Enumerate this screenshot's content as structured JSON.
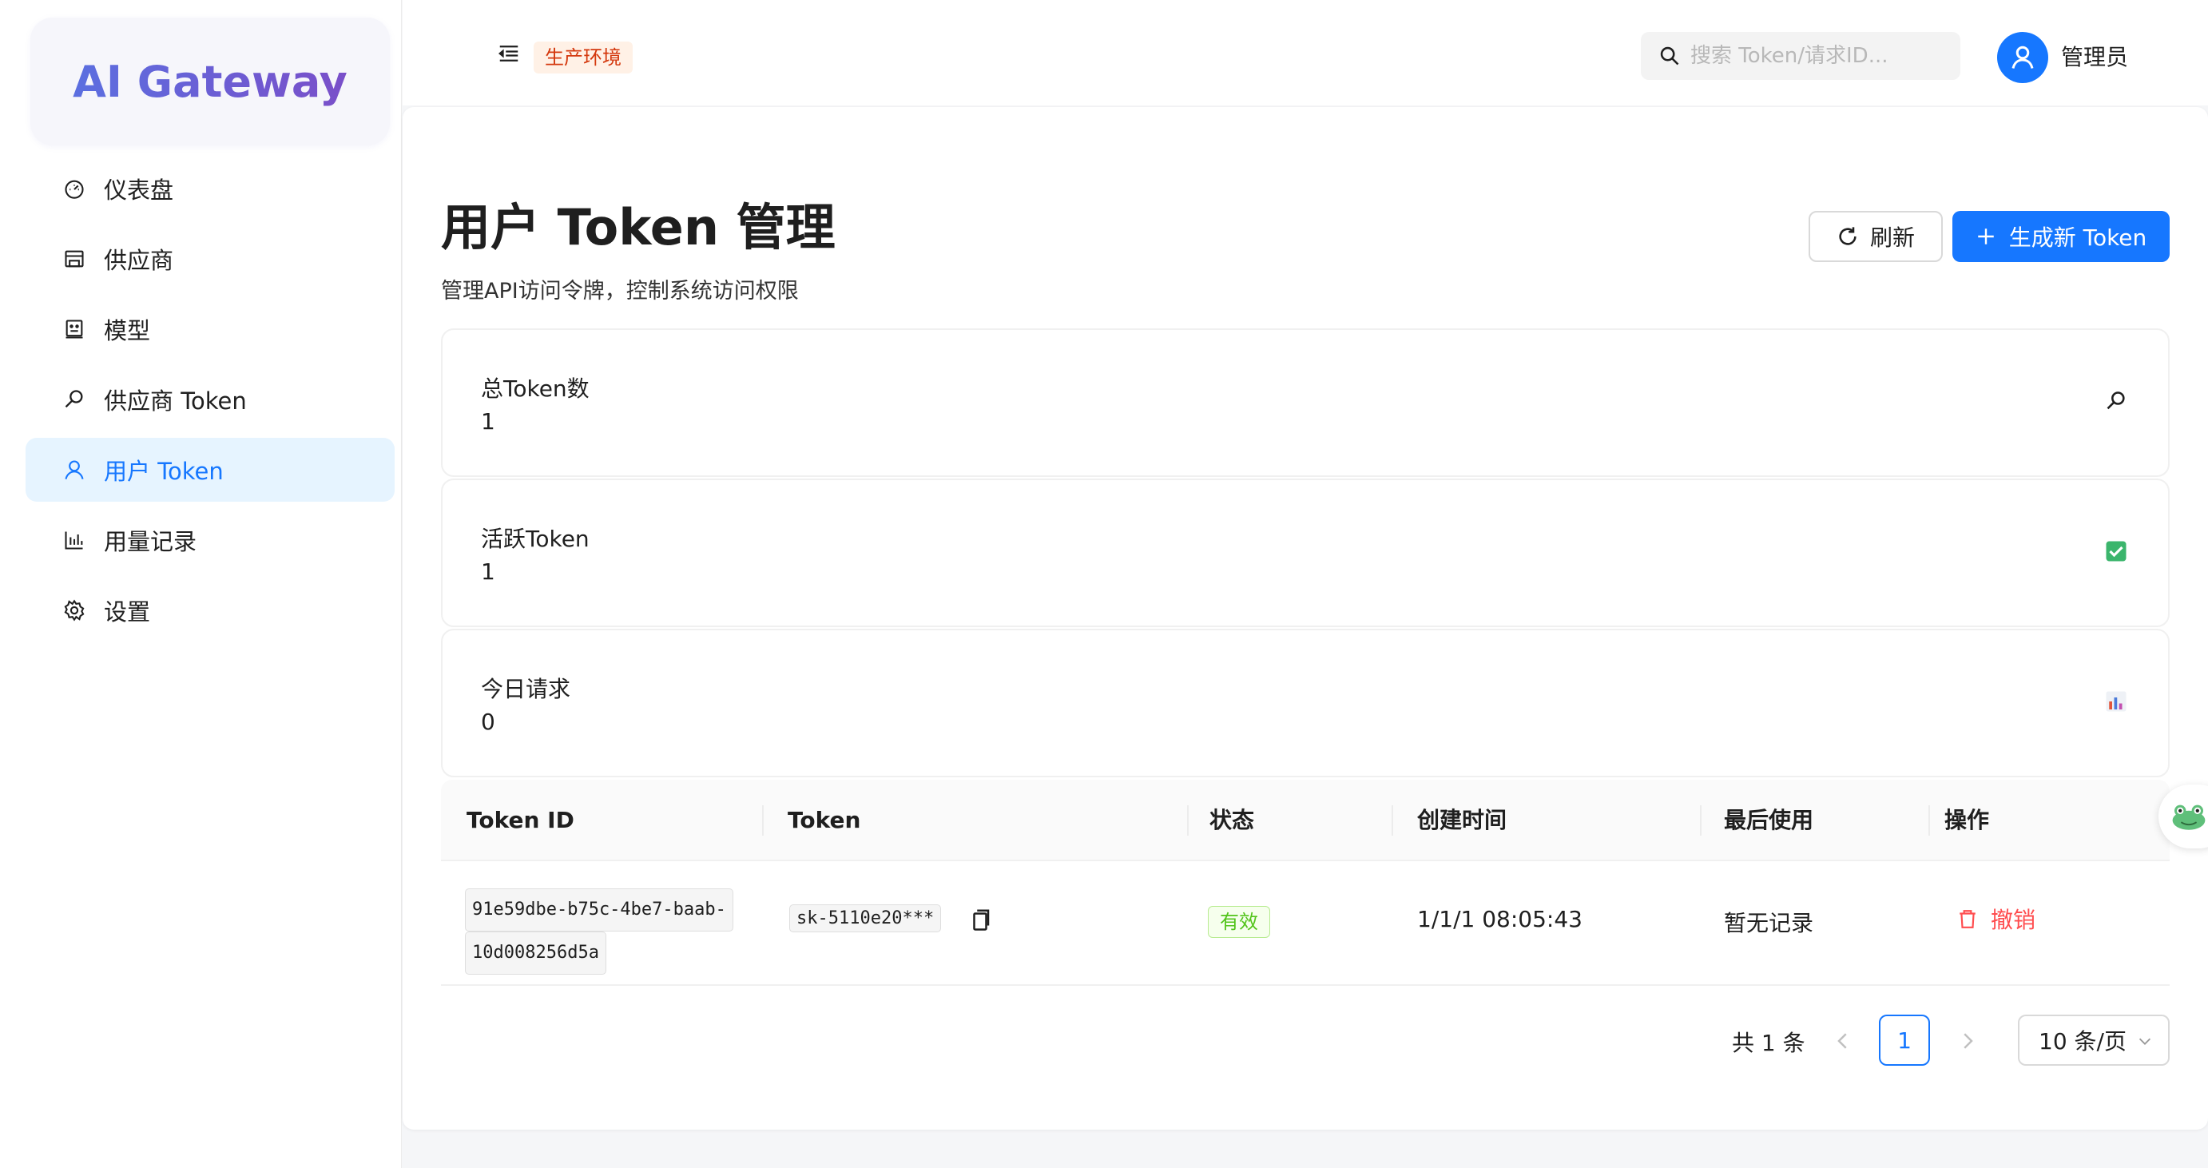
{
  "app": {
    "logo": "AI Gateway"
  },
  "sidebar": {
    "items": [
      {
        "label": "仪表盘",
        "icon": "dashboard-icon",
        "active": false
      },
      {
        "label": "供应商",
        "icon": "shop-icon",
        "active": false
      },
      {
        "label": "模型",
        "icon": "robot-icon",
        "active": false
      },
      {
        "label": "供应商 Token",
        "icon": "key-icon",
        "active": false
      },
      {
        "label": "用户 Token",
        "icon": "user-icon",
        "active": true
      },
      {
        "label": "用量记录",
        "icon": "bar-chart-icon",
        "active": false
      },
      {
        "label": "设置",
        "icon": "gear-icon",
        "active": false
      }
    ]
  },
  "header": {
    "env_badge": "生产环境",
    "search_placeholder": "搜索 Token/请求ID...",
    "user_name": "管理员"
  },
  "page": {
    "title": "用户 Token 管理",
    "description": "管理API访问令牌，控制系统访问权限",
    "refresh_label": "刷新",
    "new_token_label": "生成新 Token"
  },
  "stats": [
    {
      "label": "总Token数",
      "value": "1",
      "icon": "key-icon"
    },
    {
      "label": "活跃Token",
      "value": "1",
      "icon": "check-box-icon"
    },
    {
      "label": "今日请求",
      "value": "0",
      "icon": "chart-icon"
    }
  ],
  "table": {
    "columns": [
      "Token ID",
      "Token",
      "状态",
      "创建时间",
      "最后使用",
      "操作"
    ],
    "rows": [
      {
        "id_line1": "91e59dbe-b75c-4be7-baab-",
        "id_line2": "10d008256d5a",
        "token": "sk-5110e20***",
        "status": "有效",
        "created": "1/1/1 08:05:43",
        "last_used": "暂无记录",
        "action": "撤销"
      }
    ]
  },
  "pagination": {
    "total": "共 1 条",
    "current": "1",
    "page_size": "10 条/页"
  },
  "colors": {
    "primary": "#1677ff",
    "danger": "#ff4d4f",
    "success": "#52c41a",
    "env": "#d4380d"
  }
}
